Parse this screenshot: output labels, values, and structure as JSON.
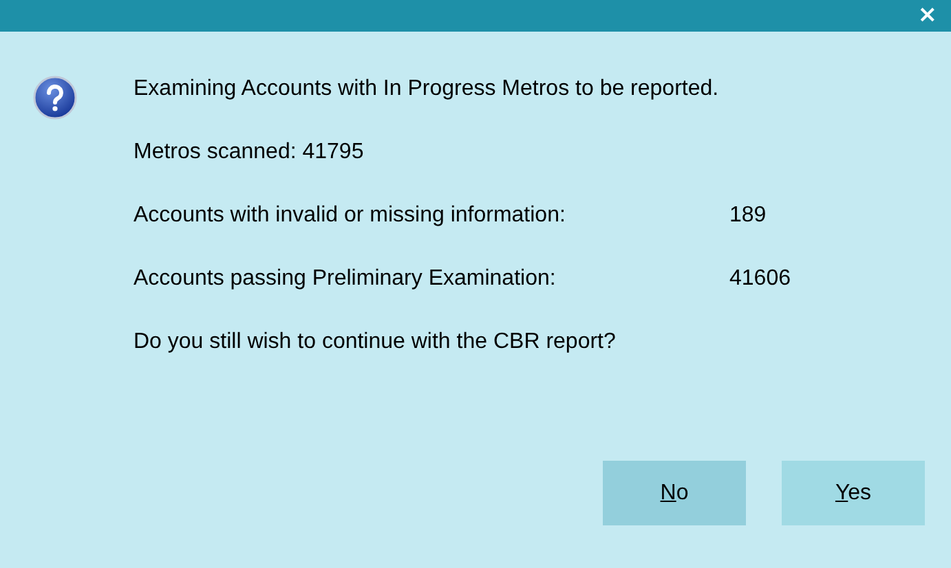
{
  "window": {
    "close": "×"
  },
  "message": "Examining Accounts with In Progress Metros to be reported.",
  "lines": [
    {
      "label": "Metros scanned: 41795"
    },
    {
      "label": "Accounts with invalid or missing information:",
      "value": "189"
    },
    {
      "label": "Accounts passing Preliminary Examination:",
      "value": "41606"
    }
  ],
  "question": "Do you still wish to continue with the CBR report?",
  "buttons": [
    {
      "label": "No",
      "focused": true
    },
    {
      "label": "Yes",
      "focused": false
    }
  ]
}
